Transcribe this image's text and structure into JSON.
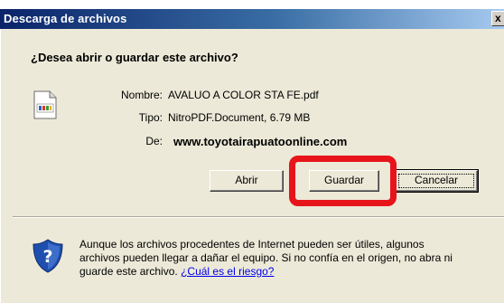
{
  "window": {
    "title": "Descarga de archivos",
    "close_label": "x"
  },
  "prompt": {
    "question": "¿Desea abrir o guardar este archivo?"
  },
  "file": {
    "icon": "pdf-file-icon",
    "name_label": "Nombre:",
    "name_value": "AVALUO A COLOR STA FE.pdf",
    "type_label": "Tipo:",
    "type_value": "NitroPDF.Document, 6.79 MB",
    "from_label": "De:",
    "from_value": "www.toyotairapuatoonline.com"
  },
  "buttons": {
    "open": "Abrir",
    "save": "Guardar",
    "cancel": "Cancelar"
  },
  "warning": {
    "icon": "security-shield-icon",
    "text": "Aunque los archivos procedentes de Internet pueden ser útiles, algunos archivos pueden llegar a dañar el equipo. Si no confía en el origen, no abra ni guarde este archivo.",
    "link": "¿Cuál es el riesgo?"
  },
  "colors": {
    "title_bar": "#0a246a",
    "dialog_bg": "#ece9d8",
    "highlight": "#e8141b",
    "link": "#0000ee"
  }
}
